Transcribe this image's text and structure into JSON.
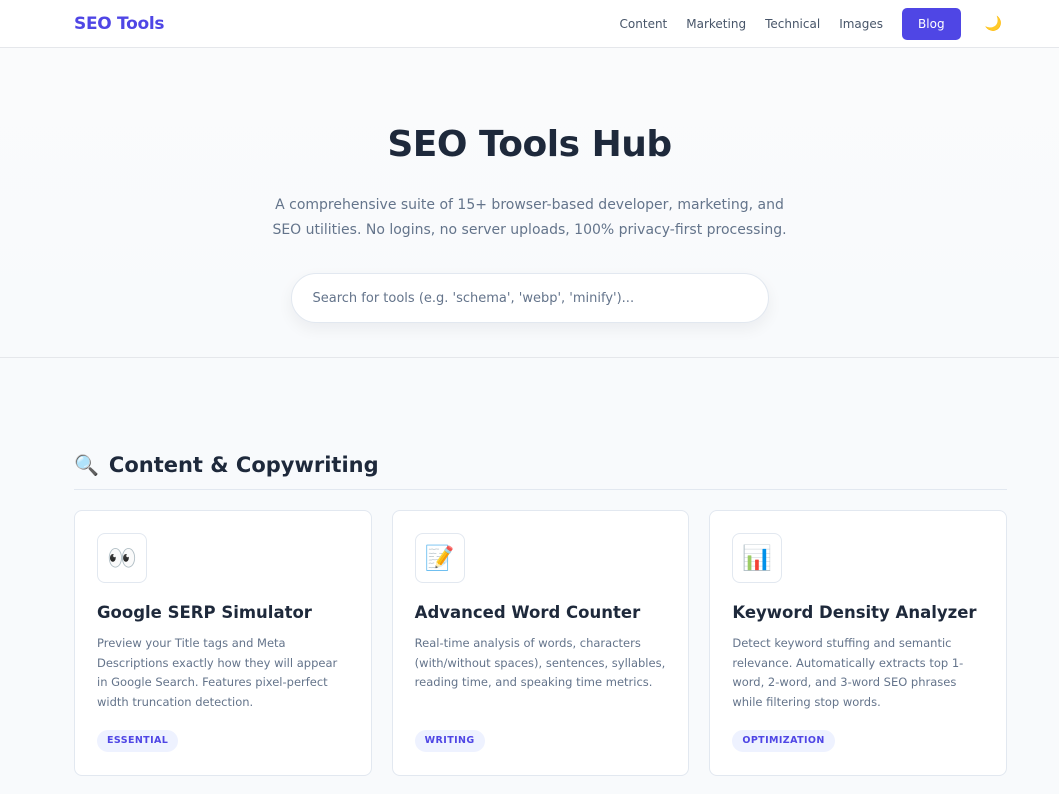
{
  "navbar": {
    "logo": "SEO Tools",
    "links": [
      "Content",
      "Marketing",
      "Technical",
      "Images"
    ],
    "blog_label": "Blog",
    "theme_icon": "🌙"
  },
  "hero": {
    "title": "SEO Tools Hub",
    "subtitle": "A comprehensive suite of 15+ browser-based developer, marketing, and SEO utilities. No logins, no server uploads, 100% privacy-first processing.",
    "search_placeholder": "Search for tools (e.g. 'schema', 'webp', 'minify')..."
  },
  "section": {
    "icon": "🔍",
    "title": "Content & Copywriting",
    "cards": [
      {
        "icon": "👀",
        "title": "Google SERP Simulator",
        "description": "Preview your Title tags and Meta Descriptions exactly how they will appear in Google Search. Features pixel-perfect width truncation detection.",
        "badge": "ESSENTIAL"
      },
      {
        "icon": "📝",
        "title": "Advanced Word Counter",
        "description": "Real-time analysis of words, characters (with/without spaces), sentences, syllables, reading time, and speaking time metrics.",
        "badge": "WRITING"
      },
      {
        "icon": "📊",
        "title": "Keyword Density Analyzer",
        "description": "Detect keyword stuffing and semantic relevance. Automatically extracts top 1-word, 2-word, and 3-word SEO phrases while filtering stop words.",
        "badge": "OPTIMIZATION"
      }
    ]
  },
  "colors": {
    "accent": "#4f46e5",
    "badge_bg": "#eef2ff",
    "text_dark": "#1e293b",
    "text_muted": "#64748b"
  }
}
